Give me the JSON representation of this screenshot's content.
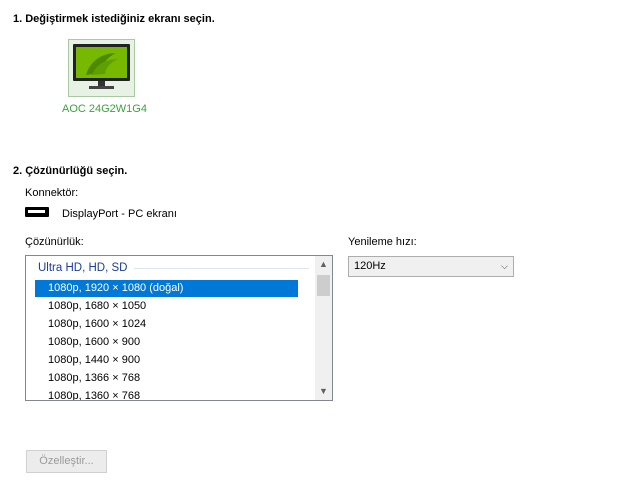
{
  "step1": {
    "heading": "1. Değiştirmek istediğiniz ekranı seçin."
  },
  "monitor": {
    "name": "AOC 24G2W1G4",
    "icon": "nvidia-monitor-icon"
  },
  "step2": {
    "heading": "2. Çözünürlüğü seçin."
  },
  "connector": {
    "label": "Konnektör:",
    "value": "DisplayPort - PC ekranı",
    "icon": "displayport-icon"
  },
  "resolution": {
    "label": "Çözünürlük:",
    "group": "Ultra HD, HD, SD",
    "items": [
      "1080p, 1920 × 1080 (doğal)",
      "1080p, 1680 × 1050",
      "1080p, 1600 × 1024",
      "1080p, 1600 × 900",
      "1080p, 1440 × 900",
      "1080p, 1366 × 768",
      "1080p, 1360 × 768"
    ],
    "selected_index": 0
  },
  "refresh": {
    "label": "Yenileme hızı:",
    "value": "120Hz"
  },
  "customize": {
    "label": "Özelleştir..."
  },
  "colors": {
    "selection": "#0078d7",
    "monitor_name": "#3aa43a",
    "group_header": "#1b3d94"
  }
}
